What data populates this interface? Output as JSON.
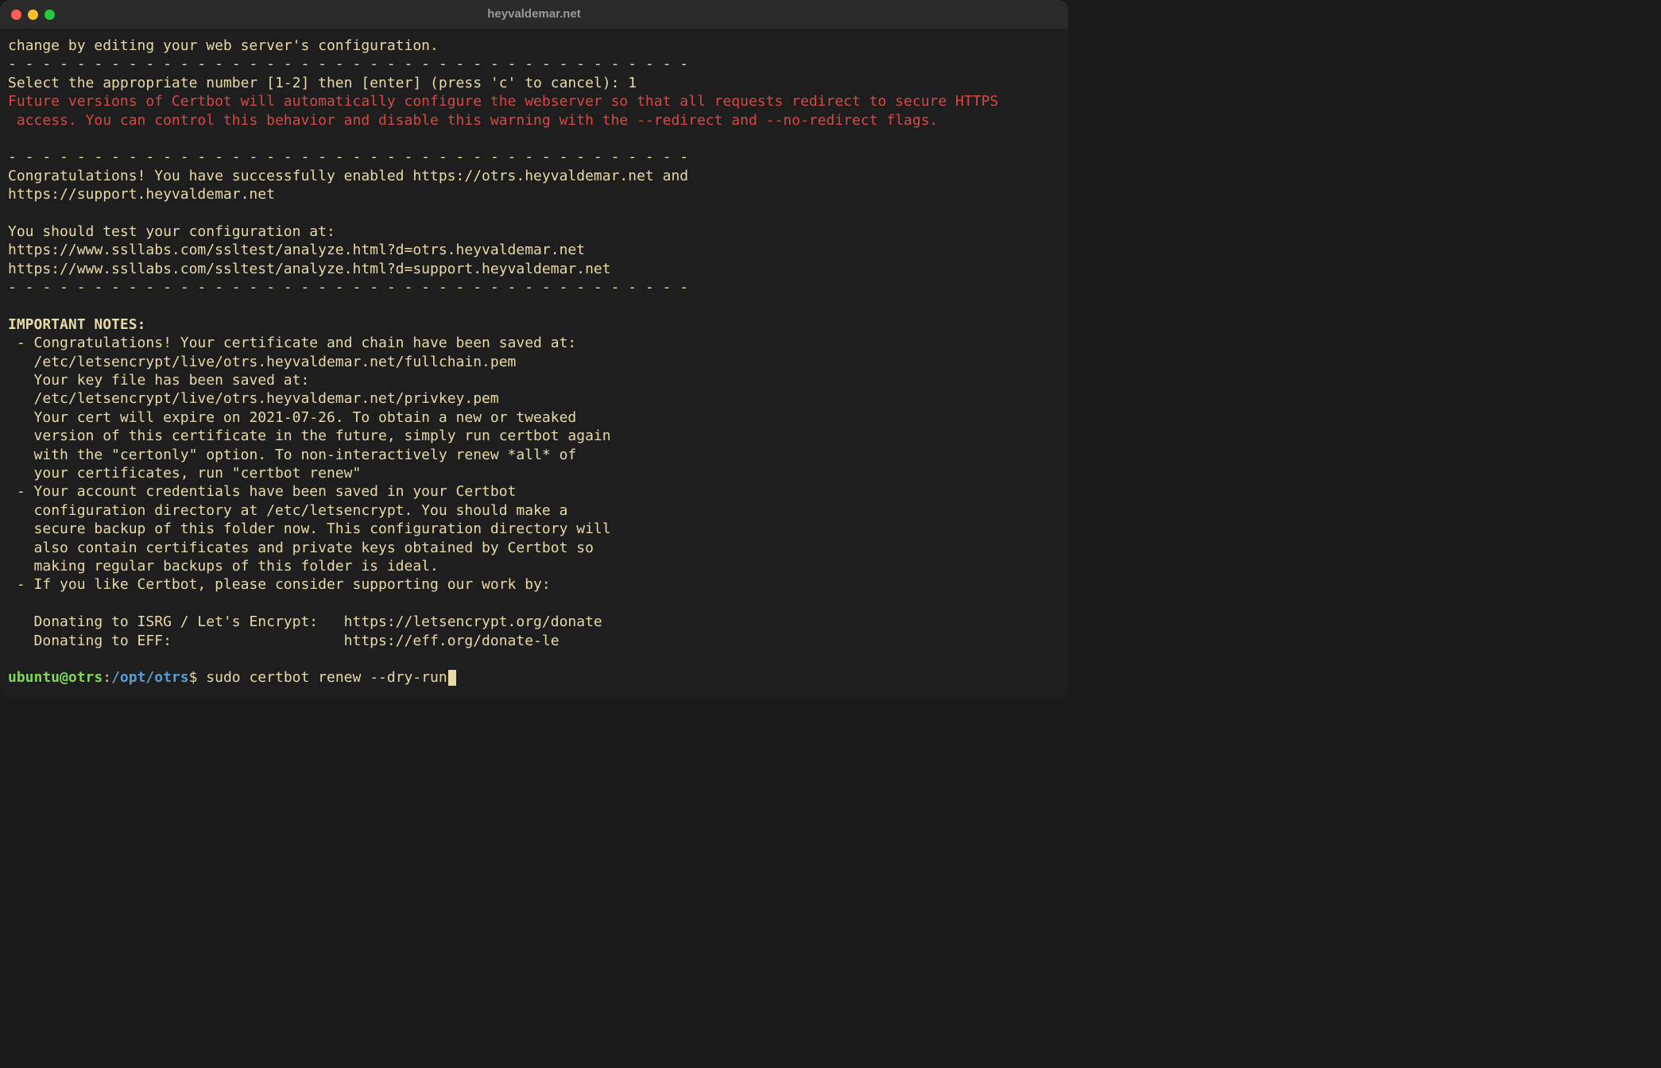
{
  "window": {
    "title": "heyvaldemar.net"
  },
  "output": {
    "l1": "change by editing your web server's configuration.",
    "l2": "- - - - - - - - - - - - - - - - - - - - - - - - - - - - - - - - - - - - - - - -",
    "l3": "Select the appropriate number [1-2] then [enter] (press 'c' to cancel): 1",
    "l4": "Future versions of Certbot will automatically configure the webserver so that all requests redirect to secure HTTPS",
    "l5": " access. You can control this behavior and disable this warning with the --redirect and --no-redirect flags.",
    "l6": "",
    "l7": "- - - - - - - - - - - - - - - - - - - - - - - - - - - - - - - - - - - - - - - -",
    "l8": "Congratulations! You have successfully enabled https://otrs.heyvaldemar.net and",
    "l9": "https://support.heyvaldemar.net",
    "l10": "",
    "l11": "You should test your configuration at:",
    "l12": "https://www.ssllabs.com/ssltest/analyze.html?d=otrs.heyvaldemar.net",
    "l13": "https://www.ssllabs.com/ssltest/analyze.html?d=support.heyvaldemar.net",
    "l14": "- - - - - - - - - - - - - - - - - - - - - - - - - - - - - - - - - - - - - - - -",
    "l15": "",
    "l16": "IMPORTANT NOTES:",
    "l17": " - Congratulations! Your certificate and chain have been saved at:",
    "l18": "   /etc/letsencrypt/live/otrs.heyvaldemar.net/fullchain.pem",
    "l19": "   Your key file has been saved at:",
    "l20": "   /etc/letsencrypt/live/otrs.heyvaldemar.net/privkey.pem",
    "l21": "   Your cert will expire on 2021-07-26. To obtain a new or tweaked",
    "l22": "   version of this certificate in the future, simply run certbot again",
    "l23": "   with the \"certonly\" option. To non-interactively renew *all* of",
    "l24": "   your certificates, run \"certbot renew\"",
    "l25": " - Your account credentials have been saved in your Certbot",
    "l26": "   configuration directory at /etc/letsencrypt. You should make a",
    "l27": "   secure backup of this folder now. This configuration directory will",
    "l28": "   also contain certificates and private keys obtained by Certbot so",
    "l29": "   making regular backups of this folder is ideal.",
    "l30": " - If you like Certbot, please consider supporting our work by:",
    "l31": "",
    "l32": "   Donating to ISRG / Let's Encrypt:   https://letsencrypt.org/donate",
    "l33": "   Donating to EFF:                    https://eff.org/donate-le",
    "l34": ""
  },
  "prompt": {
    "user_host": "ubuntu@otrs",
    "colon": ":",
    "path": "/opt/otrs",
    "symbol": "$",
    "command": " sudo certbot renew --dry-run"
  }
}
